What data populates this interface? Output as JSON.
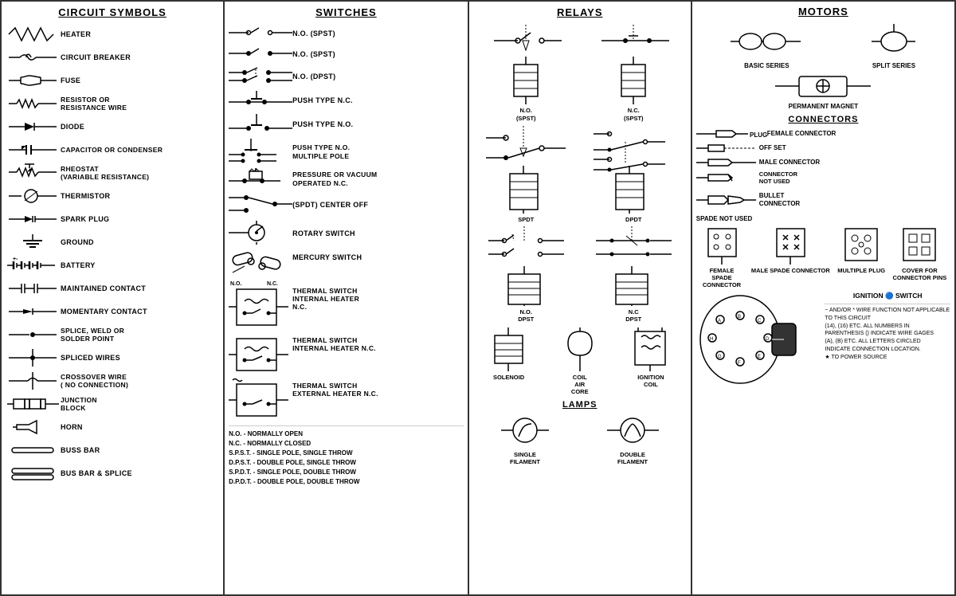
{
  "sections": {
    "circuit_symbols": {
      "title": "CIRCUIT SYMBOLS",
      "items": [
        {
          "label": "HEATER"
        },
        {
          "label": "CIRCUIT BREAKER"
        },
        {
          "label": "FUSE"
        },
        {
          "label": "RESISTOR OR\nRESISTANCE WIRE"
        },
        {
          "label": "DIODE"
        },
        {
          "label": "CAPACITOR OR CONDENSER"
        },
        {
          "label": "RHEOSTAT\n(VARIABLE RESISTANCE)"
        },
        {
          "label": "THERMISTOR"
        },
        {
          "label": "SPARK PLUG"
        },
        {
          "label": "GROUND"
        },
        {
          "label": "BATTERY"
        },
        {
          "label": "MAINTAINED CONTACT"
        },
        {
          "label": "MOMENTARY CONTACT"
        },
        {
          "label": "SPLICE, WELD OR\nSOLDER POINT"
        },
        {
          "label": "SPLICED WIRES"
        },
        {
          "label": "CROSSOVER WIRE\n( NO CONNECTION)"
        },
        {
          "label": "JUNCTION\nBLOCK"
        },
        {
          "label": "HORN"
        },
        {
          "label": "BUSS BAR"
        },
        {
          "label": "BUS BAR & SPLICE"
        }
      ]
    },
    "switches": {
      "title": "SWITCHES",
      "items": [
        {
          "label": "N.O. (SPST)"
        },
        {
          "label": "N.O. (SPST)"
        },
        {
          "label": "N.O. (DPST)"
        },
        {
          "label": "PUSH TYPE N.C."
        },
        {
          "label": "PUSH TYPE N.O."
        },
        {
          "label": "PUSH TYPE N.O.\nMULTIPLE POLE"
        },
        {
          "label": "PRESSURE OR VACUUM\nOPERATED N.C."
        },
        {
          "label": "(SPDT) CENTER OFF"
        },
        {
          "label": "ROTARY SWITCH"
        },
        {
          "label": "MERCURY SWITCH"
        },
        {
          "label": "THERMAL SWITCH\nINTERNAL HEATER\nN.C."
        },
        {
          "label": "THERMAL SWITCH\nINTERNAL HEATER N.C."
        },
        {
          "label": "THERMAL SWITCH\nEXTERNAL HEATER N.C."
        }
      ],
      "notes": [
        "N.O. - NORMALLY OPEN",
        "N.C. - NORMALLY CLOSED",
        "S.P.S.T. - SINGLE POLE, SINGLE THROW",
        "D.P.S.T. - DOUBLE POLE, SINGLE THROW",
        "S.P.D.T. - SINGLE POLE, DOUBLE THROW",
        "D.P.D.T. - DOUBLE POLE, DOUBLE THROW"
      ]
    },
    "relays": {
      "title": "RELAYS",
      "lamps_title": "LAMPS",
      "items_top": [
        {
          "label": "N.O.\n(SPST)"
        },
        {
          "label": "N.C.\n(SPST)"
        }
      ],
      "items_mid": [
        {
          "label": "SPDT"
        },
        {
          "label": "DPDT"
        }
      ],
      "items_bot": [
        {
          "label": "N.O.\nDPST"
        },
        {
          "label": "N.C\nDPST"
        }
      ],
      "solenoid": "SOLENOID",
      "coil": "COIL\nAIR\nCORE",
      "ignition_coil": "IGNITION\nCOIL",
      "single_filament": "SINGLE\nFILAMENT",
      "double_filament": "DOUBLE\nFILAMENT"
    },
    "motors": {
      "title": "MOTORS",
      "basic_series": "BASIC SERIES",
      "split_series": "SPLIT SERIES",
      "permanent_magnet": "PERMANENT MAGNET",
      "connectors_title": "CONNECTORS",
      "plug": "PLUG",
      "female_connector": "FEMALE CONNECTOR",
      "off_set": "OFF SET",
      "male_connector": "MALE CONNECTOR",
      "connector_not_used": "CONNECTOR\nNOT USED",
      "bullet_connector": "BULLET\nCONNECTOR",
      "spade_not_used": "SPADE NOT USED",
      "multiple_plug": "MULTIPLE\nPLUG",
      "cover_for": "COVER FOR\nCONNECTOR PINS",
      "female_spade": "FEMALE\nSPADE\nCONNECTOR",
      "male_spade": "MALE SPADE\nCONNECTOR",
      "ignition": "IGNITION",
      "switch": "SWITCH",
      "small_note": "~ AND/OR * WIRE FUNCTION NOT APPLICABLE\nTO THIS CIRCUIT\n(14), (16) ETC. ALL NUMBERS IN\nPARENTHESIS () INDICATE WIRE GAGES\n(A), (B) ETC. ALL LETTERS CIRCLED\nINDICATE CONNECTION LOCATION.\n★ TO POWER SOURCE"
    }
  }
}
